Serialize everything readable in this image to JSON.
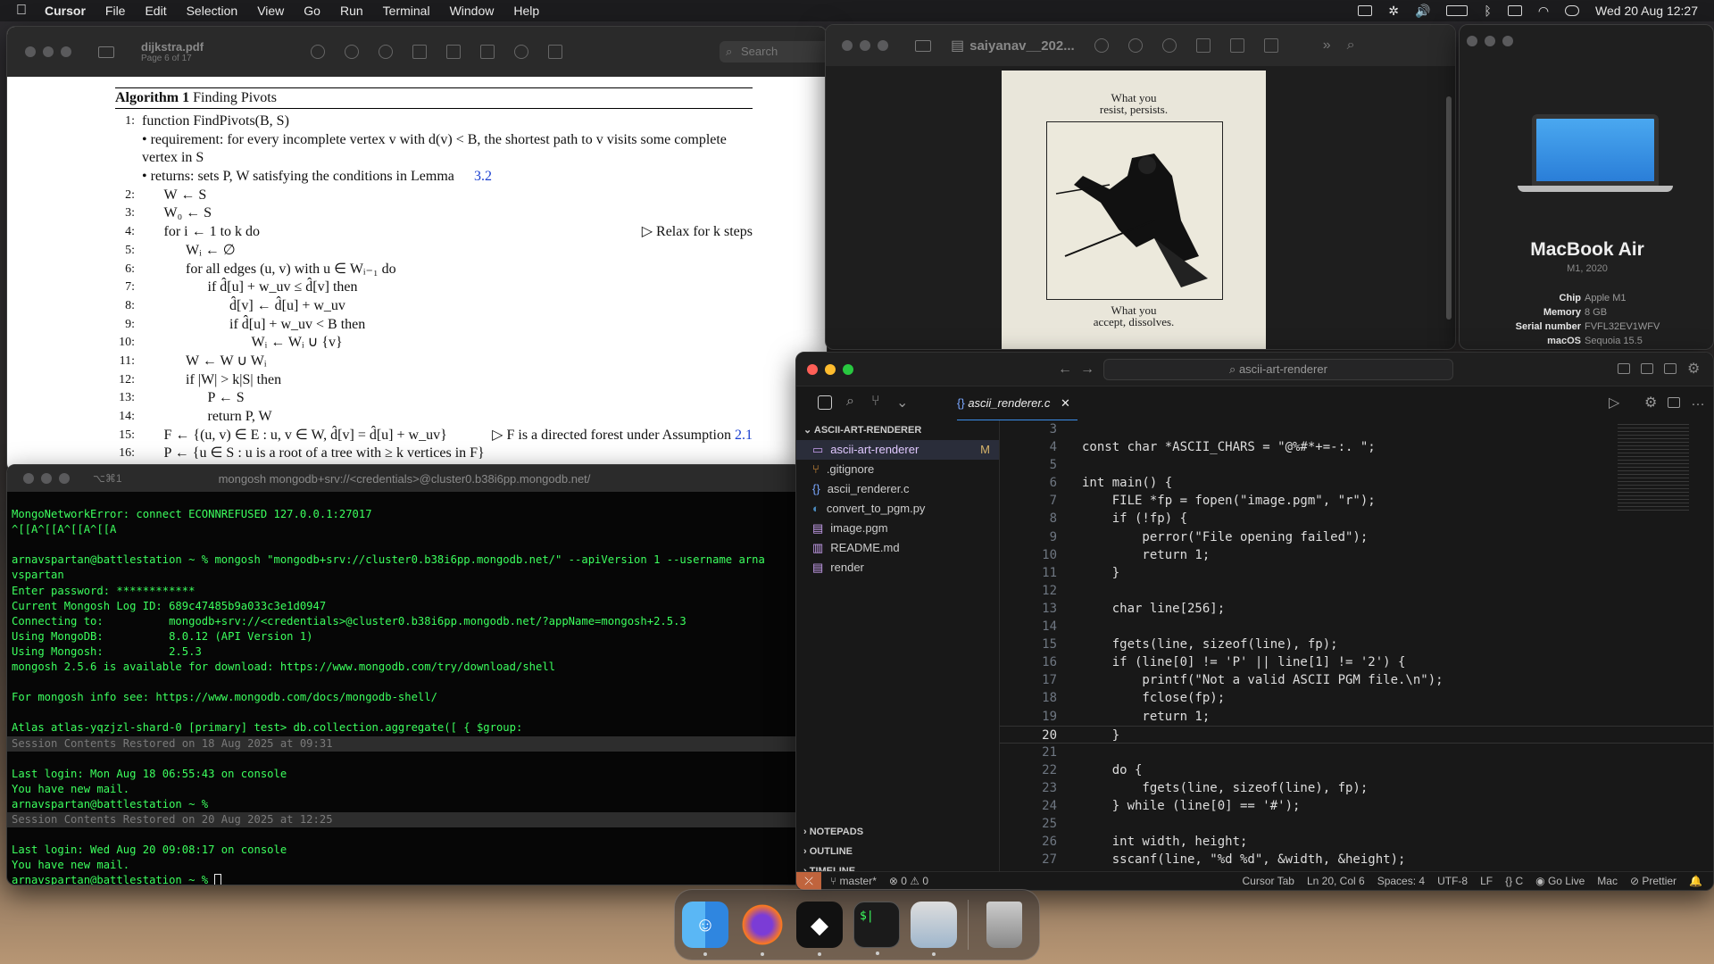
{
  "menubar": {
    "apple": "",
    "items": [
      "Cursor",
      "File",
      "Edit",
      "Selection",
      "View",
      "Go",
      "Run",
      "Terminal",
      "Window",
      "Help"
    ],
    "datetime": "Wed 20 Aug 12:27"
  },
  "pdf": {
    "filename": "dijkstra.pdf",
    "page": "Page 6 of 17",
    "search_placeholder": "Search",
    "algo_title_bold": "Algorithm 1",
    "algo_title": "Finding Pivots",
    "lines": [
      {
        "n": "1:",
        "t": "function FindPivots(B, S)",
        "ind": 0
      },
      {
        "n": "",
        "t": "• requirement: for every incomplete vertex v with d(v) < B, the shortest path to v visits some complete",
        "ind": 0
      },
      {
        "n": "",
        "t": "vertex in S",
        "ind": 0
      },
      {
        "n": "",
        "t": "• returns: sets P, W satisfying the conditions in Lemma",
        "ind": 0,
        "ref": "3.2"
      },
      {
        "n": "2:",
        "t": "W ← S",
        "ind": 1
      },
      {
        "n": "3:",
        "t": "W₀ ← S",
        "ind": 1
      },
      {
        "n": "4:",
        "t": "for i ← 1 to k do",
        "ind": 1,
        "cmt": "▷ Relax for k steps"
      },
      {
        "n": "5:",
        "t": "Wᵢ ← ∅",
        "ind": 2
      },
      {
        "n": "6:",
        "t": "for all edges (u, v) with u ∈ Wᵢ₋₁ do",
        "ind": 2
      },
      {
        "n": "7:",
        "t": "if d̂[u] + w_uv ≤ d̂[v] then",
        "ind": 3
      },
      {
        "n": "8:",
        "t": "d̂[v] ← d̂[u] + w_uv",
        "ind": 4
      },
      {
        "n": "9:",
        "t": "if d̂[u] + w_uv < B then",
        "ind": 4
      },
      {
        "n": "10:",
        "t": "Wᵢ ← Wᵢ ∪ {v}",
        "ind": 5
      },
      {
        "n": "11:",
        "t": "W ← W ∪ Wᵢ",
        "ind": 2
      },
      {
        "n": "12:",
        "t": "if |W| > k|S| then",
        "ind": 2
      },
      {
        "n": "13:",
        "t": "P ← S",
        "ind": 3
      },
      {
        "n": "14:",
        "t": "return P, W",
        "ind": 3
      },
      {
        "n": "15:",
        "t": "F ← {(u, v) ∈ E : u, v ∈ W, d̂[v] = d̂[u] + w_uv}",
        "ind": 1,
        "cmt": "▷ F is a directed forest under Assumption",
        "cref": "2.1"
      },
      {
        "n": "16:",
        "t": "P ← {u ∈ S : u is a root of a tree with ≥ k vertices in F}",
        "ind": 1
      }
    ]
  },
  "preview2": {
    "filename": "saiyanav__202...",
    "poster_top": [
      "What you",
      "resist, persists."
    ],
    "poster_bottom": [
      "What you",
      "accept, dissolves."
    ]
  },
  "about": {
    "model": "MacBook Air",
    "year": "M1, 2020",
    "specs": [
      {
        "k": "Chip",
        "v": "Apple M1"
      },
      {
        "k": "Memory",
        "v": "8 GB"
      },
      {
        "k": "Serial number",
        "v": "FVFL32EV1WFV"
      },
      {
        "k": "macOS",
        "v": "Sequoia 15.5"
      }
    ]
  },
  "terminal": {
    "shortcut": "⌥⌘1",
    "title": "mongosh mongodb+srv://<credentials>@cluster0.b38i6pp.mongodb.net/",
    "lines": [
      {
        "t": "",
        "c": ""
      },
      {
        "t": "MongoNetworkError: connect ECONNREFUSED 127.0.0.1:27017",
        "c": ""
      },
      {
        "t": "^[[A^[[A^[[A^[[A",
        "c": ""
      },
      {
        "t": "",
        "c": ""
      },
      {
        "t": "arnavspartan@battlestation ~ % mongosh \"mongodb+srv://cluster0.b38i6pp.mongodb.net/\" --apiVersion 1 --username arna",
        "c": ""
      },
      {
        "t": "vspartan",
        "c": ""
      },
      {
        "t": "Enter password: ************",
        "c": ""
      },
      {
        "t": "Current Mongosh Log ID: 689c47485b9a033c3e1d0947",
        "c": ""
      },
      {
        "t": "Connecting to:          mongodb+srv://<credentials>@cluster0.b38i6pp.mongodb.net/?appName=mongosh+2.5.3",
        "c": ""
      },
      {
        "t": "Using MongoDB:          8.0.12 (API Version 1)",
        "c": ""
      },
      {
        "t": "Using Mongosh:          2.5.3",
        "c": ""
      },
      {
        "t": "mongosh 2.5.6 is available for download: https://www.mongodb.com/try/download/shell",
        "c": ""
      },
      {
        "t": "",
        "c": ""
      },
      {
        "t": "For mongosh info see: https://www.mongodb.com/docs/mongodb-shell/",
        "c": ""
      },
      {
        "t": "",
        "c": ""
      },
      {
        "t": "Atlas atlas-yqzjzl-shard-0 [primary] test> db.collection.aggregate([ { $group:",
        "c": ""
      },
      {
        "t": "Session Contents Restored on 18 Aug 2025 at 09:31",
        "c": "tgrey"
      },
      {
        "t": "",
        "c": ""
      },
      {
        "t": "Last login: Mon Aug 18 06:55:43 on console",
        "c": ""
      },
      {
        "t": "You have new mail.",
        "c": ""
      },
      {
        "t": "arnavspartan@battlestation ~ %",
        "c": ""
      },
      {
        "t": "Session Contents Restored on 20 Aug 2025 at 12:25",
        "c": "tgrey"
      },
      {
        "t": "",
        "c": ""
      },
      {
        "t": "Last login: Wed Aug 20 09:08:17 on console",
        "c": ""
      },
      {
        "t": "You have new mail.",
        "c": ""
      },
      {
        "t": "arnavspartan@battlestation ~ % ",
        "c": "",
        "cursor": true
      }
    ]
  },
  "editor": {
    "search": "ascii-art-renderer",
    "tab": "ascii_renderer.c",
    "explorer_title": "ASCII-ART-RENDERER",
    "files": [
      {
        "name": "ascii-art-renderer",
        "icon": "folder-icon",
        "badge": "M",
        "sel": true
      },
      {
        "name": ".gitignore",
        "icon": "git-icon"
      },
      {
        "name": "ascii_renderer.c",
        "icon": "c-icon"
      },
      {
        "name": "convert_to_pgm.py",
        "icon": "python-icon"
      },
      {
        "name": "image.pgm",
        "icon": "file-icon"
      },
      {
        "name": "README.md",
        "icon": "book-icon"
      },
      {
        "name": "render",
        "icon": "file-icon"
      }
    ],
    "sections": [
      "NOTEPADS",
      "OUTLINE",
      "TIMELINE"
    ],
    "code": [
      {
        "n": "3",
        "t": ""
      },
      {
        "n": "4",
        "t": "const char *ASCII_CHARS = \"@%#*+=-:. \";"
      },
      {
        "n": "5",
        "t": ""
      },
      {
        "n": "6",
        "t": "int main() {"
      },
      {
        "n": "7",
        "t": "    FILE *fp = fopen(\"image.pgm\", \"r\");"
      },
      {
        "n": "8",
        "t": "    if (!fp) {"
      },
      {
        "n": "9",
        "t": "        perror(\"File opening failed\");"
      },
      {
        "n": "10",
        "t": "        return 1;"
      },
      {
        "n": "11",
        "t": "    }"
      },
      {
        "n": "12",
        "t": ""
      },
      {
        "n": "13",
        "t": "    char line[256];"
      },
      {
        "n": "14",
        "t": ""
      },
      {
        "n": "15",
        "t": "    fgets(line, sizeof(line), fp);"
      },
      {
        "n": "16",
        "t": "    if (line[0] != 'P' || line[1] != '2') {"
      },
      {
        "n": "17",
        "t": "        printf(\"Not a valid ASCII PGM file.\\n\");"
      },
      {
        "n": "18",
        "t": "        fclose(fp);"
      },
      {
        "n": "19",
        "t": "        return 1;"
      },
      {
        "n": "20",
        "t": "    }",
        "cur": true
      },
      {
        "n": "21",
        "t": ""
      },
      {
        "n": "22",
        "t": "    do {"
      },
      {
        "n": "23",
        "t": "        fgets(line, sizeof(line), fp);"
      },
      {
        "n": "24",
        "t": "    } while (line[0] == '#');"
      },
      {
        "n": "25",
        "t": ""
      },
      {
        "n": "26",
        "t": "    int width, height;"
      },
      {
        "n": "27",
        "t": "    sscanf(line, \"%d %d\", &width, &height);"
      },
      {
        "n": "28",
        "t": ""
      }
    ],
    "status": {
      "branch": "master*",
      "errors": "0",
      "warnings": "0",
      "cursor_tab": "Cursor Tab",
      "pos": "Ln 20, Col 6",
      "spaces": "Spaces: 4",
      "enc": "UTF-8",
      "eol": "LF",
      "lang": "C",
      "live": "Go Live",
      "os": "Mac",
      "prettier": "Prettier"
    }
  },
  "dock": [
    "finder-icon",
    "firefox-icon",
    "unity-icon",
    "terminal-icon",
    "preview-icon",
    "trash-icon"
  ],
  "colors": {
    "accent": "#3cff5e",
    "blue_link": "#1a3fd0",
    "yellow": "#ffd866"
  }
}
